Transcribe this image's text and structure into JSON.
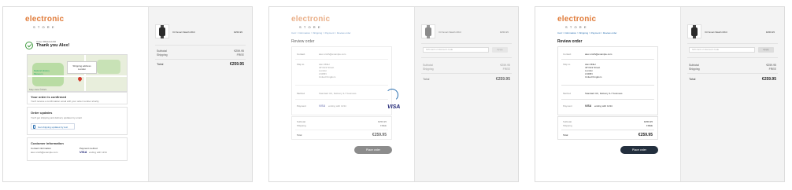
{
  "brand": {
    "name": "electronic",
    "sub": "STORE"
  },
  "panel1": {
    "order_no": "Order #BMH12456",
    "thanks": "Thank you Alex!",
    "map_tip_line1": "Shipping address",
    "map_tip_line2": "London",
    "map_label_left": "Natural History Museum",
    "map_footer": "Map data ©2021",
    "confirmed_title": "Your order is confirmed",
    "confirmed_text": "You'll receive a confirmation email with your order number shortly.",
    "updates_title": "Order updates",
    "updates_text": "You'll get shipping and delivery updates by email.",
    "updates_link": "Get shipping updates by text",
    "customer_title": "Customer information",
    "contact_label": "Contact information",
    "contact_value": "alex.smith@example.com",
    "payment_label": "Payment method",
    "payment_brand": "VISA",
    "payment_value": "ending with 1234"
  },
  "product": {
    "name": "X3 Smart Watch MK3",
    "price": "€259.95"
  },
  "summary": {
    "subtotal_label": "Subtotal",
    "subtotal_value": "€259.95",
    "shipping_label": "Shipping",
    "shipping_value": "FREE",
    "total_label": "Total",
    "total_value": "€259.95"
  },
  "review": {
    "breadcrumb": "Cart > Information > Shipping > Payment > Review order",
    "title": "Review order",
    "contact_label": "Contact",
    "contact_value": "alex.smith@example.com",
    "ship_label": "Ship to",
    "ship_lines": [
      "Alex Miller",
      "4P Dick Street",
      "London",
      "LN1BN",
      "United Kingdom"
    ],
    "method_label": "Method",
    "method_value": "Standard UK, Delivery 3-7 business",
    "payment_label": "Payment",
    "payment_brand": "VISA",
    "payment_value": "ending with 1234",
    "subtotal_label": "Subtotal",
    "subtotal_value": "€259.95",
    "shipping_label": "Shipping",
    "shipping_value": "FREE",
    "total_label": "Total",
    "total_value": "€259.95",
    "button": "Place order",
    "visa_big": "VISA"
  },
  "discount": {
    "placeholder": "Gift card or discount code",
    "apply": "Apply"
  }
}
